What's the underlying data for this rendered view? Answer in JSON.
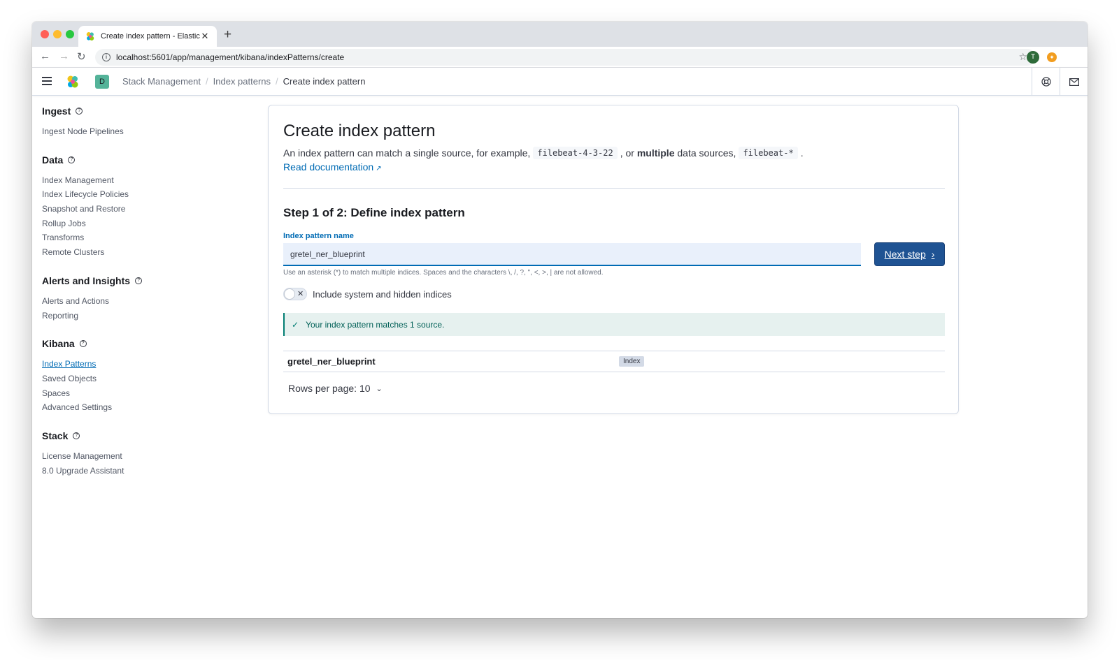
{
  "browser": {
    "tab_title": "Create index pattern - Elastic",
    "tab_close": "✕",
    "new_tab": "+",
    "url": "localhost:5601/app/management/kibana/indexPatterns/create",
    "profile_initial": "T"
  },
  "header": {
    "space_initial": "D",
    "breadcrumbs": [
      {
        "label": "Stack Management"
      },
      {
        "label": "Index patterns"
      },
      {
        "label": "Create index pattern"
      }
    ],
    "separator": "/"
  },
  "sidebar": {
    "sections": [
      {
        "title": "Ingest",
        "items": [
          "Ingest Node Pipelines"
        ]
      },
      {
        "title": "Data",
        "items": [
          "Index Management",
          "Index Lifecycle Policies",
          "Snapshot and Restore",
          "Rollup Jobs",
          "Transforms",
          "Remote Clusters"
        ]
      },
      {
        "title": "Alerts and Insights",
        "items": [
          "Alerts and Actions",
          "Reporting"
        ]
      },
      {
        "title": "Kibana",
        "items": [
          "Index Patterns",
          "Saved Objects",
          "Spaces",
          "Advanced Settings"
        ]
      },
      {
        "title": "Stack",
        "items": [
          "License Management",
          "8.0 Upgrade Assistant"
        ]
      }
    ],
    "active_item": "Index Patterns"
  },
  "main": {
    "title": "Create index pattern",
    "description": {
      "part1": "An index pattern can match a single source, for example,",
      "code1": "filebeat-4-3-22",
      "part2": ", or",
      "bold": "multiple",
      "part3": "data sources,",
      "code2": "filebeat-*",
      "part4": "."
    },
    "read_doc_label": "Read documentation",
    "step_title": "Step 1 of 2: Define index pattern",
    "field_label": "Index pattern name",
    "input_value": "gretel_ner_blueprint",
    "next_button_label": "Next step",
    "help_text": "Use an asterisk (*) to match multiple indices. Spaces and the characters \\, /, ?, \", <, >, | are not allowed.",
    "toggle_label": "Include system and hidden indices",
    "toggle_on": false,
    "callout_text": "Your index pattern matches 1 source.",
    "table_rows": [
      {
        "name": "gretel_ner_blueprint",
        "badge": "Index"
      }
    ],
    "rows_per_page_label": "Rows per page: 10"
  },
  "colors": {
    "primary": "#006bb4",
    "button": "#1f5393",
    "success": "#017d73"
  }
}
